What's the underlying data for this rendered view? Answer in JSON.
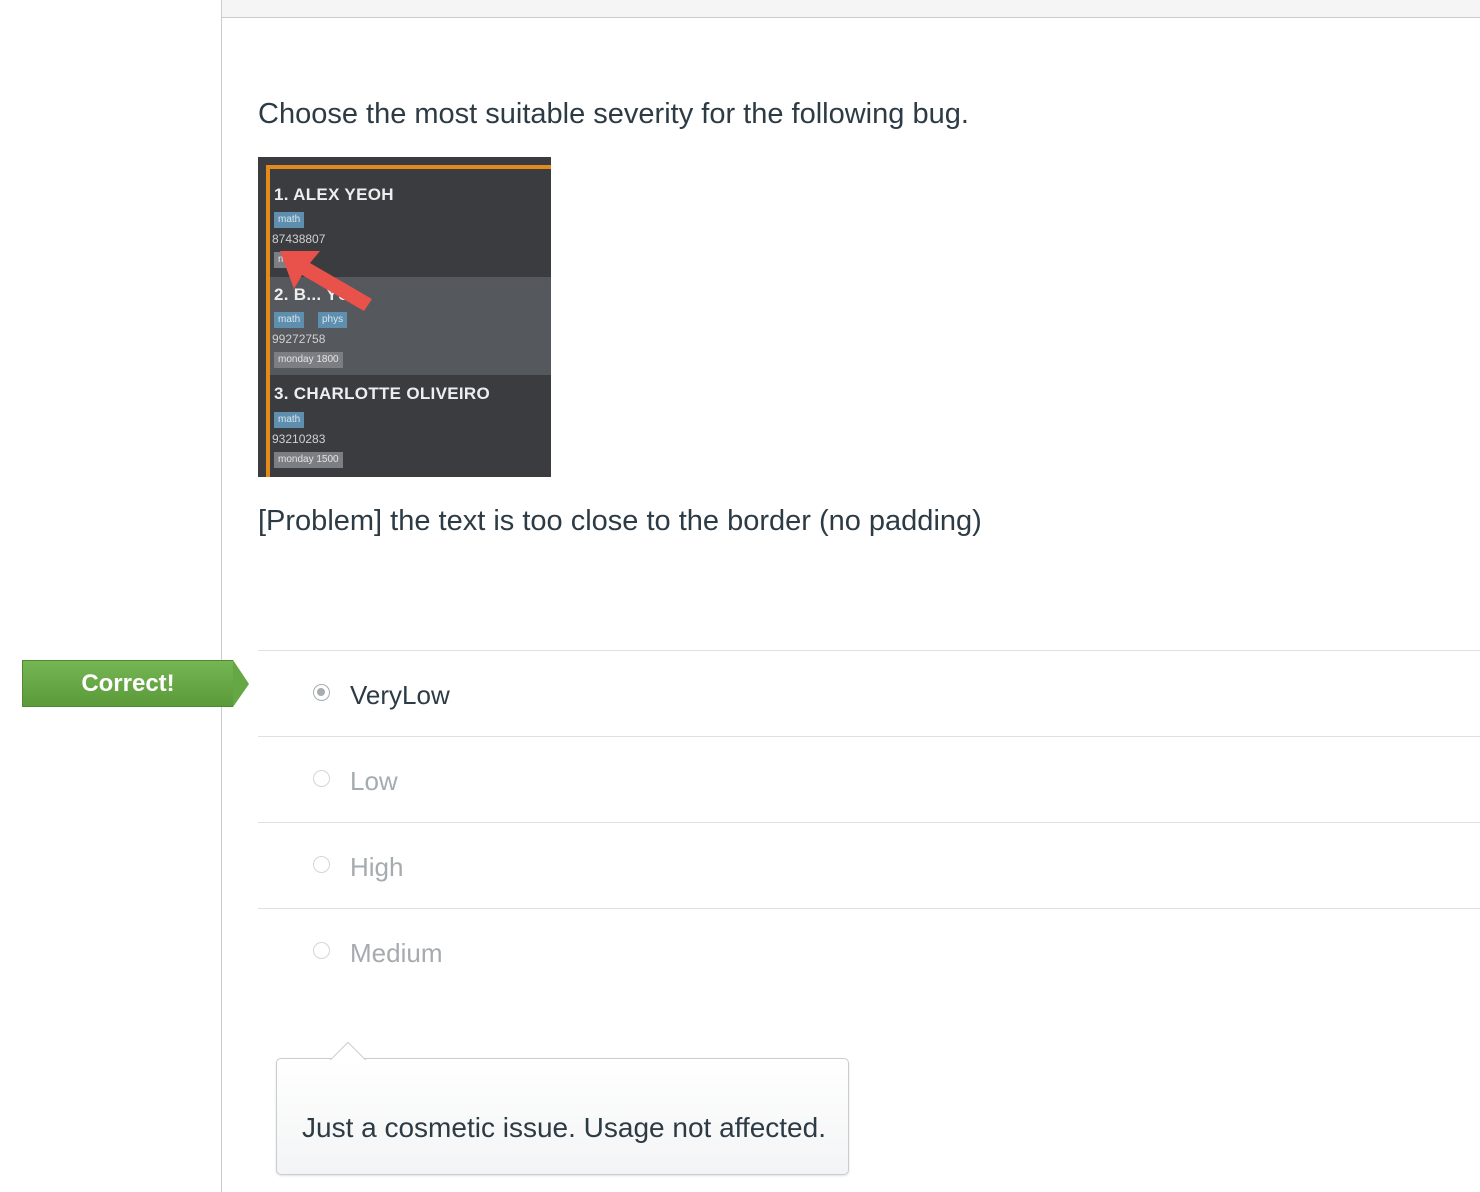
{
  "question": {
    "prompt": "Choose the most suitable severity for the following bug.",
    "problem": "[Problem] the text is too close to the border (no padding)"
  },
  "bug_screenshot": {
    "cards": [
      {
        "name": "1.  ALEX YEOH",
        "tags": [
          "math"
        ],
        "phone": "87438807",
        "time": "m...0"
      },
      {
        "name": "2.  B...  YU",
        "tags": [
          "math",
          "phys"
        ],
        "phone": "99272758",
        "time": "monday 1800"
      },
      {
        "name": "3.  CHARLOTTE OLIVEIRO",
        "tags": [
          "math"
        ],
        "phone": "93210283",
        "time": "monday 1500"
      }
    ],
    "colors": {
      "background": "#3a3c3f",
      "border": "#e48a1c",
      "arrow": "#e8524a",
      "tag": "#5f8fae"
    }
  },
  "result_flag": {
    "label": "Correct!",
    "color": "#66a745"
  },
  "answers": [
    {
      "label": "VeryLow",
      "selected": true
    },
    {
      "label": "Low",
      "selected": false
    },
    {
      "label": "High",
      "selected": false
    },
    {
      "label": "Medium",
      "selected": false
    }
  ],
  "feedback": {
    "text": "Just a cosmetic issue. Usage not affected."
  }
}
